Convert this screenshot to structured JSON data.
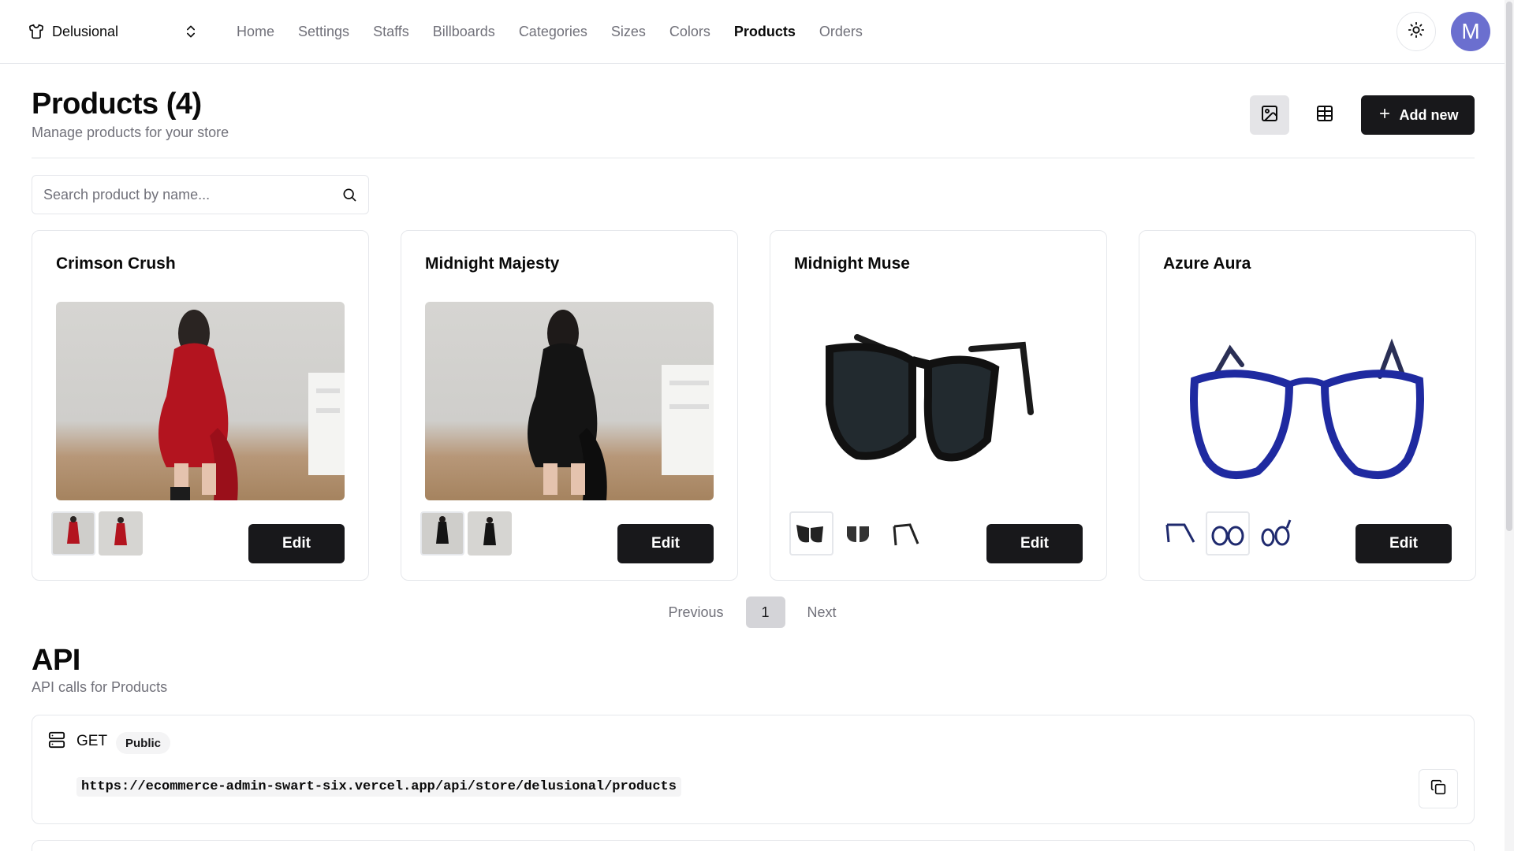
{
  "store_switcher": {
    "name": "Delusional"
  },
  "nav": {
    "items": [
      {
        "label": "Home",
        "active": false
      },
      {
        "label": "Settings",
        "active": false
      },
      {
        "label": "Staffs",
        "active": false
      },
      {
        "label": "Billboards",
        "active": false
      },
      {
        "label": "Categories",
        "active": false
      },
      {
        "label": "Sizes",
        "active": false
      },
      {
        "label": "Colors",
        "active": false
      },
      {
        "label": "Products",
        "active": true
      },
      {
        "label": "Orders",
        "active": false
      }
    ]
  },
  "user": {
    "avatar_letter": "M",
    "avatar_color": "#6b6fcf"
  },
  "page": {
    "title": "Products (4)",
    "subtitle": "Manage products for your store",
    "add_new_label": "Add new",
    "view_modes": [
      "image-icon",
      "table-icon"
    ],
    "active_view": "image-icon"
  },
  "search": {
    "placeholder": "Search product by name...",
    "value": ""
  },
  "products": [
    {
      "name": "Crimson Crush",
      "edit_label": "Edit",
      "image": "red-dress",
      "thumbnails": [
        "red-dress",
        "red-dress"
      ],
      "selected_thumb": 0
    },
    {
      "name": "Midnight Majesty",
      "edit_label": "Edit",
      "image": "black-dress",
      "thumbnails": [
        "black-dress",
        "black-dress"
      ],
      "selected_thumb": 0
    },
    {
      "name": "Midnight Muse",
      "edit_label": "Edit",
      "image": "black-sunglasses",
      "thumbnails": [
        "black-sunglasses",
        "sunglasses-folded",
        "sunglasses-side"
      ],
      "selected_thumb": 0
    },
    {
      "name": "Azure Aura",
      "edit_label": "Edit",
      "image": "blue-eyeglasses",
      "thumbnails": [
        "eyeglasses-side",
        "blue-eyeglasses",
        "eyeglasses-angle"
      ],
      "selected_thumb": 1
    }
  ],
  "pagination": {
    "previous_label": "Previous",
    "current_page": "1",
    "next_label": "Next"
  },
  "api": {
    "title": "API",
    "subtitle": "API calls for Products",
    "entries": [
      {
        "method": "GET",
        "access": "Public",
        "url": "https://ecommerce-admin-swart-six.vercel.app/api/store/delusional/products"
      }
    ]
  },
  "colors": {
    "primary": "#18181b",
    "muted_text": "#71717a",
    "border": "#e5e7eb",
    "avatar": "#6b6fcf"
  }
}
